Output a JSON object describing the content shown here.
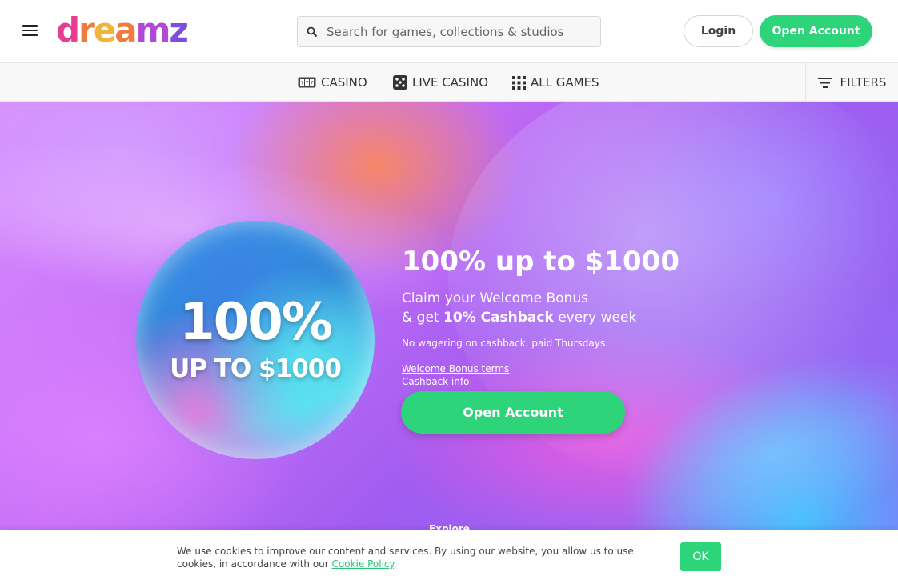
{
  "header": {
    "logo_text": "dreamz",
    "search_placeholder": "Search for games, collections & studios",
    "login_label": "Login",
    "open_account_label": "Open Account"
  },
  "nav": {
    "items": [
      {
        "label": "CASINO",
        "icon": "slot-machine-icon"
      },
      {
        "label": "LIVE CASINO",
        "icon": "dice-icon"
      },
      {
        "label": "ALL GAMES",
        "icon": "grid-icon"
      }
    ],
    "filters_label": "FILTERS"
  },
  "hero": {
    "orb_line1": "100%",
    "orb_line2": "UP TO $1000",
    "title": "100% up to $1000",
    "subtitle_line1": "Claim your Welcome Bonus",
    "subtitle_line2_prefix": "& get ",
    "subtitle_line2_bold": "10% Cashback",
    "subtitle_line2_suffix": " every week",
    "note": "No wagering on cashback, paid Thursdays.",
    "link_terms": "Welcome Bonus terms",
    "link_cashback": "Cashback info",
    "cta_label": "Open Account",
    "explore_label": "Explore"
  },
  "cookie": {
    "text": "We use cookies to improve our content and services. By using our website, you allow us to use cookies, in accordance with our ",
    "link": "Cookie Policy",
    "suffix": ".",
    "ok_label": "OK"
  },
  "colors": {
    "accent_green": "#2ed47a",
    "text_dark": "#333333"
  }
}
